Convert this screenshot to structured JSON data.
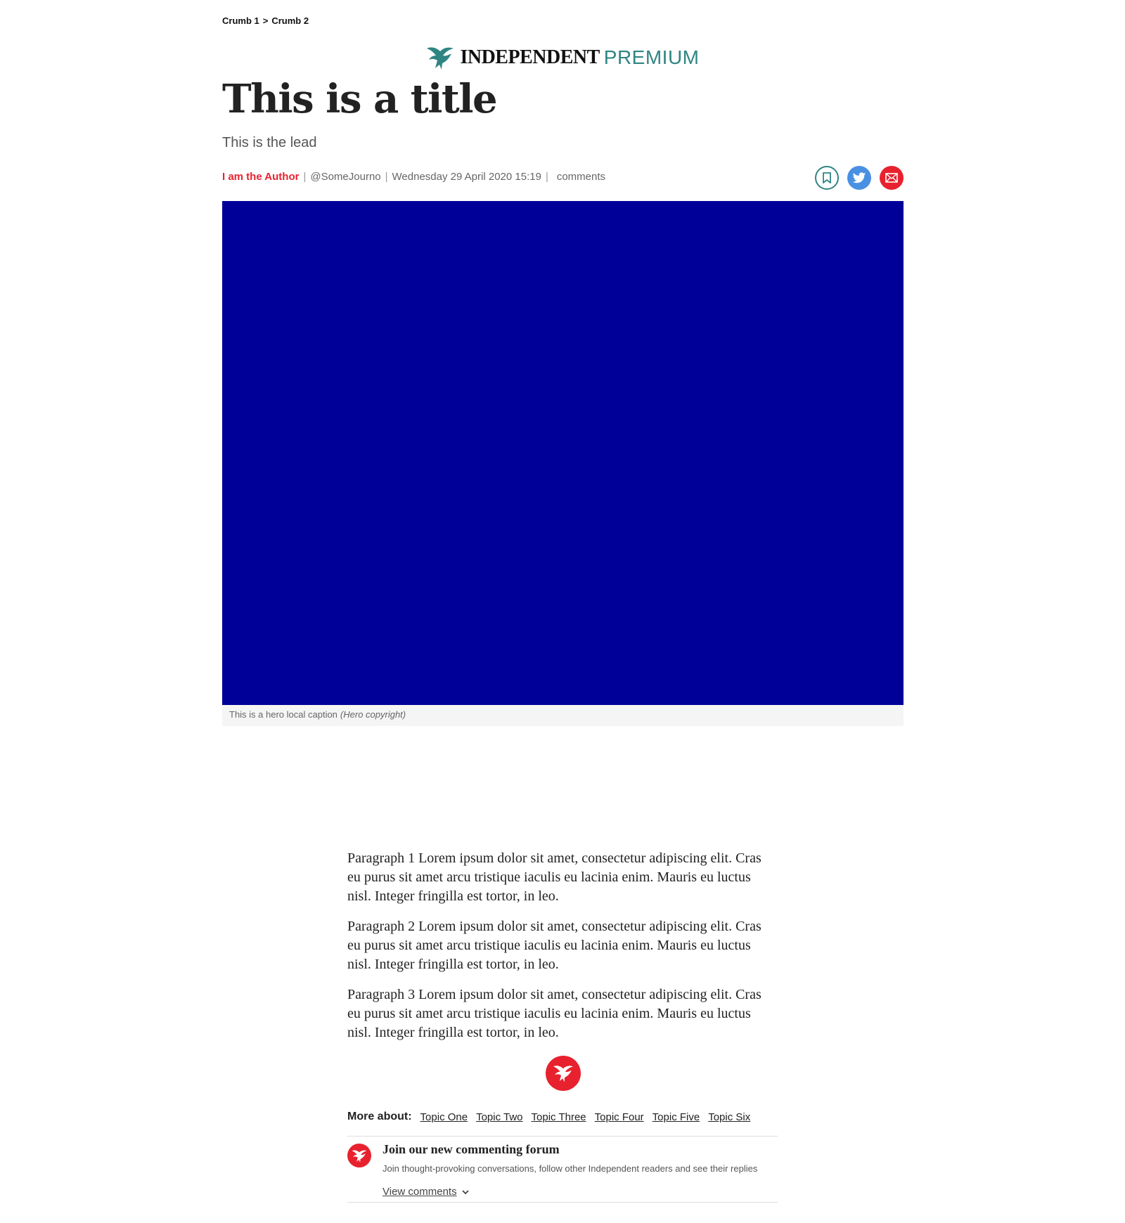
{
  "breadcrumb": {
    "items": [
      "Crumb 1",
      "Crumb 2"
    ],
    "separator": ">"
  },
  "masthead": {
    "brand": "INDEPENDENT",
    "tier": "PREMIUM",
    "accent_color": "#2f8583"
  },
  "article": {
    "title": "This is a title",
    "lead": "This is the lead",
    "author": "I am the Author",
    "handle": "@SomeJourno",
    "date": "Wednesday 29 April 2020 15:19",
    "comments_label": "comments",
    "hero": {
      "background_color": "#000099",
      "caption": "This is a hero local caption",
      "copyright": "(Hero copyright)"
    },
    "paragraphs": [
      "Paragraph 1 Lorem ipsum dolor sit amet, consectetur adipiscing elit. Cras eu purus sit amet arcu tristique iaculis eu lacinia enim. Mauris eu luctus nisl. Integer fringilla est tortor, in leo.",
      "Paragraph 2 Lorem ipsum dolor sit amet, consectetur adipiscing elit. Cras eu purus sit amet arcu tristique iaculis eu lacinia enim. Mauris eu luctus nisl. Integer fringilla est tortor, in leo.",
      "Paragraph 3 Lorem ipsum dolor sit amet, consectetur adipiscing elit. Cras eu purus sit amet arcu tristique iaculis eu lacinia enim. Mauris eu luctus nisl. Integer fringilla est tortor, in leo."
    ]
  },
  "share": {
    "icons": [
      "bookmark-icon",
      "twitter-icon",
      "email-icon"
    ],
    "colors": {
      "twitter": "#4a90e2",
      "email": "#e8212e"
    }
  },
  "more_about": {
    "label": "More about:",
    "topics": [
      "Topic One",
      "Topic Two",
      "Topic Three",
      "Topic Four",
      "Topic Five",
      "Topic Six"
    ]
  },
  "forum": {
    "title": "Join our new commenting forum",
    "description": "Join thought-provoking conversations, follow other Independent readers and see their replies",
    "view_label": "View comments"
  },
  "brand_red": "#e8212e"
}
